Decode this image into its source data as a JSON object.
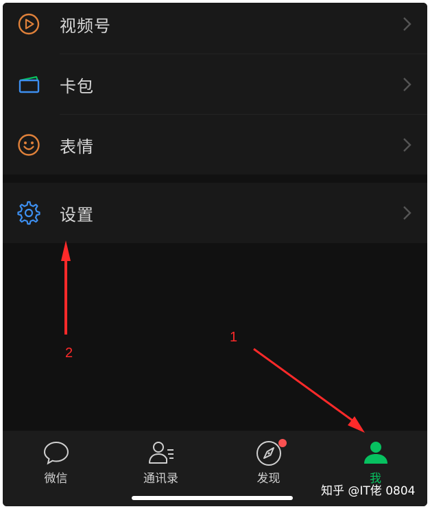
{
  "menu": {
    "items": [
      {
        "label": "视频号",
        "icon": "video-channel-icon"
      },
      {
        "label": "卡包",
        "icon": "card-wallet-icon"
      },
      {
        "label": "表情",
        "icon": "sticker-smile-icon"
      },
      {
        "label": "设置",
        "icon": "settings-gear-icon"
      }
    ]
  },
  "tabbar": {
    "tabs": [
      {
        "label": "微信",
        "icon": "chat-bubble-icon",
        "active": false
      },
      {
        "label": "通讯录",
        "icon": "contacts-icon",
        "active": false
      },
      {
        "label": "发现",
        "icon": "compass-icon",
        "active": false,
        "badge": true
      },
      {
        "label": "我",
        "icon": "profile-icon",
        "active": true
      }
    ]
  },
  "annotations": {
    "num1": "1",
    "num2": "2"
  },
  "watermark": "知乎 @IT佬 0804",
  "colors": {
    "accent_green": "#07c160",
    "orange_icon": "#e0813a",
    "blue_icon": "#3d8ff0",
    "arrow_red": "#ff2a2a",
    "badge_red": "#fa5151"
  }
}
